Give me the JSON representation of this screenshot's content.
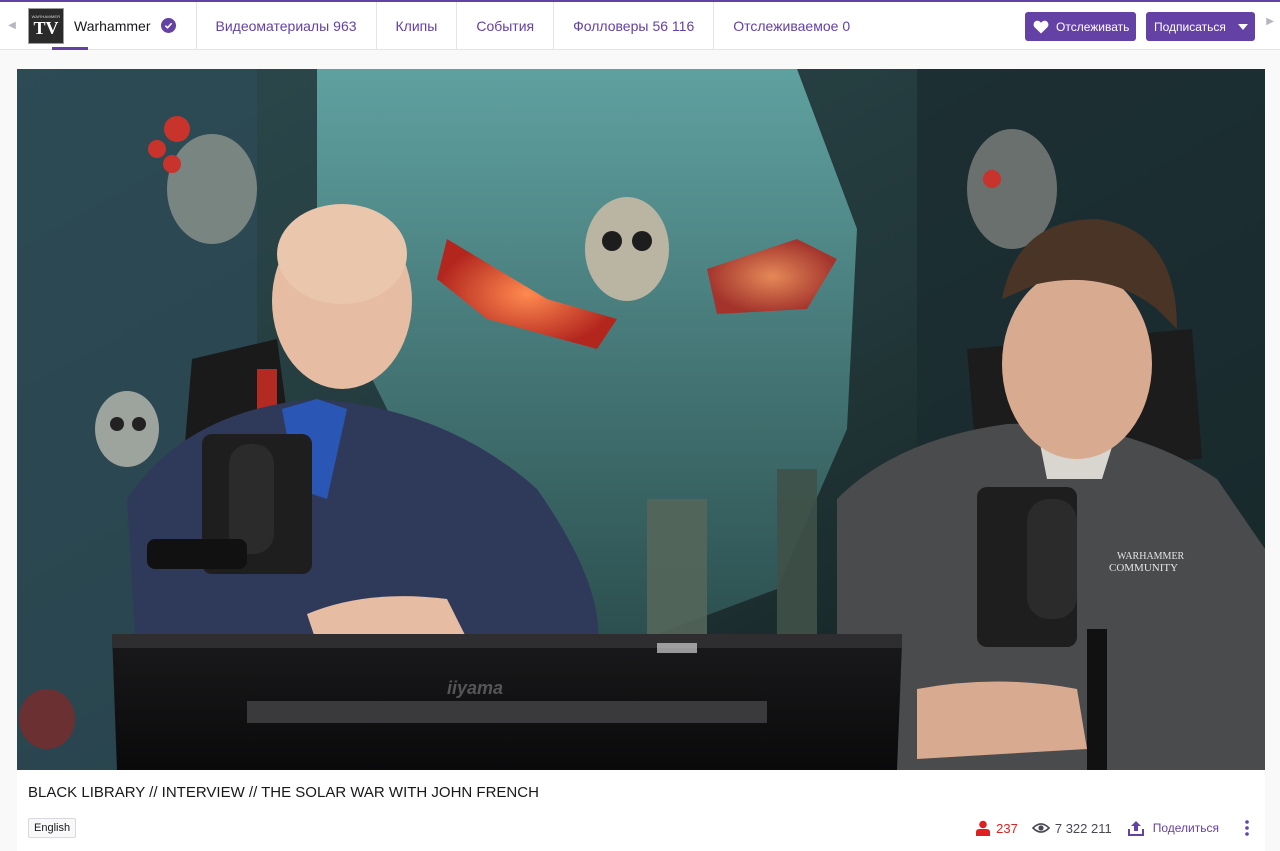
{
  "colors": {
    "accent": "#6441a4",
    "live_red": "#e02020"
  },
  "channel": {
    "logo_text": "TV",
    "logo_small_text": "WARHAMMER",
    "name": "Warhammer",
    "verified_icon": "verified-check-icon"
  },
  "nav": {
    "tabs": [
      {
        "label": "Видеоматериалы",
        "count": "963"
      },
      {
        "label": "Клипы",
        "count": ""
      },
      {
        "label": "События",
        "count": ""
      },
      {
        "label": "Фолловеры",
        "count": "56 116"
      },
      {
        "label": "Отслеживаемое",
        "count": "0"
      }
    ]
  },
  "actions": {
    "follow_label": "Отслеживать",
    "follow_icon": "heart-icon",
    "subscribe_label": "Подписаться",
    "subscribe_icon": "chevron-down-icon"
  },
  "player": {
    "monitor_brand": "iiyama",
    "shirt_logo_line1": "WARHAMMER",
    "shirt_logo_line2": "COMMUNITY"
  },
  "video": {
    "title": "BLACK LIBRARY // INTERVIEW // THE SOLAR WAR WITH JOHN FRENCH",
    "language": "English",
    "viewers": "237",
    "views": "7 322 211",
    "share_label": "Поделиться",
    "more_icon": "more-vertical-icon"
  }
}
